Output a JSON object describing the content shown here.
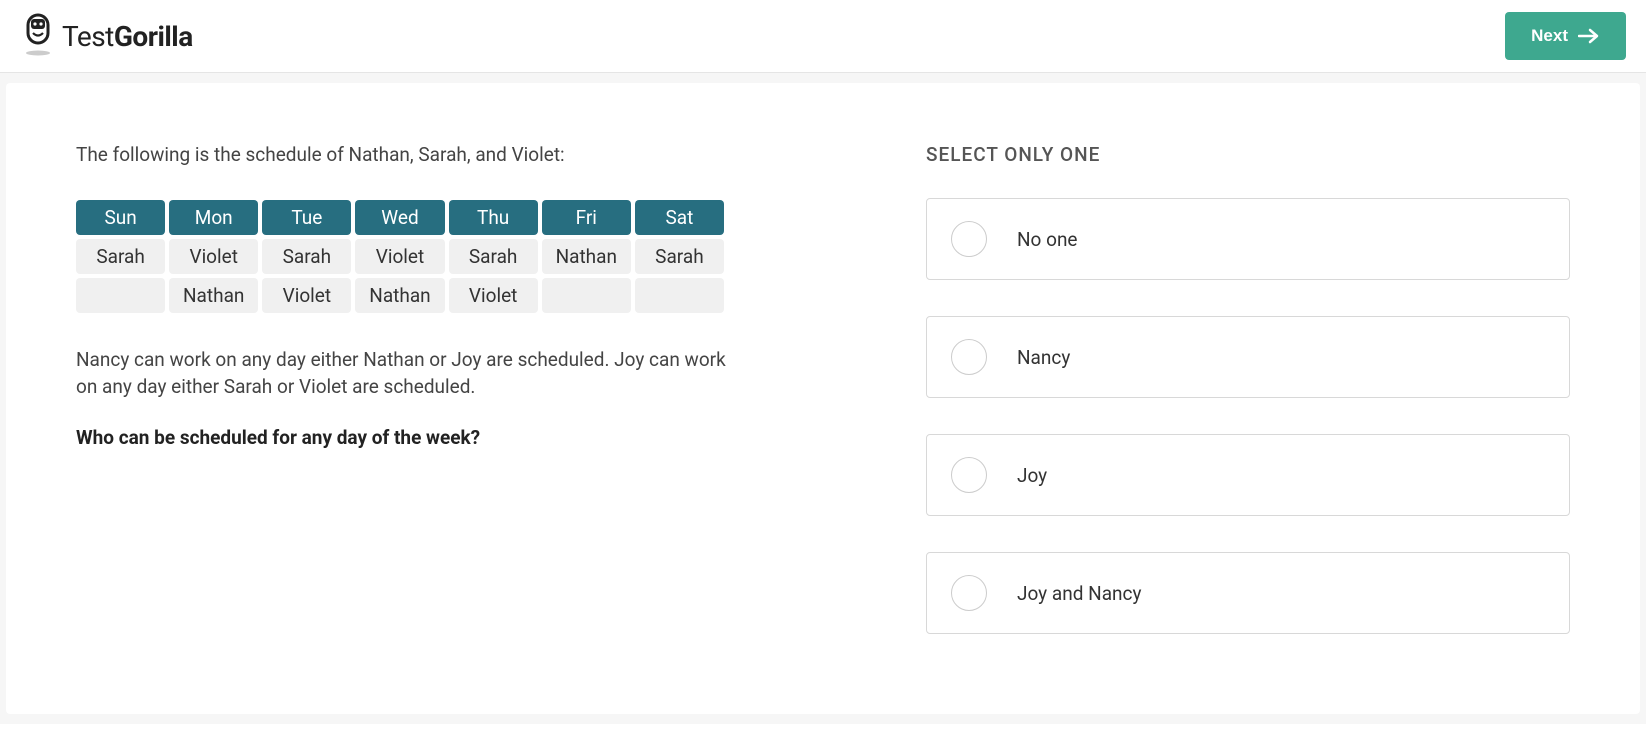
{
  "brand": {
    "text_light": "Test",
    "text_bold": "Gorilla"
  },
  "header": {
    "next_label": "Next"
  },
  "question": {
    "intro": "The following is the schedule of Nathan, Sarah, and Violet:",
    "schedule": {
      "headers": [
        "Sun",
        "Mon",
        "Tue",
        "Wed",
        "Thu",
        "Fri",
        "Sat"
      ],
      "row1": [
        "Sarah",
        "Violet",
        "Sarah",
        "Violet",
        "Sarah",
        "Nathan",
        "Sarah"
      ],
      "row2": [
        "",
        "Nathan",
        "Violet",
        "Nathan",
        "Violet",
        "",
        ""
      ]
    },
    "note": "Nancy can work on any day either Nathan or Joy are scheduled. Joy can work on any day either Sarah or Violet are scheduled.",
    "prompt": "Who can be scheduled for any day of the week?"
  },
  "answers": {
    "instruction": "SELECT ONLY ONE",
    "options": [
      "No one",
      "Nancy",
      "Joy",
      "Joy and Nancy"
    ]
  }
}
